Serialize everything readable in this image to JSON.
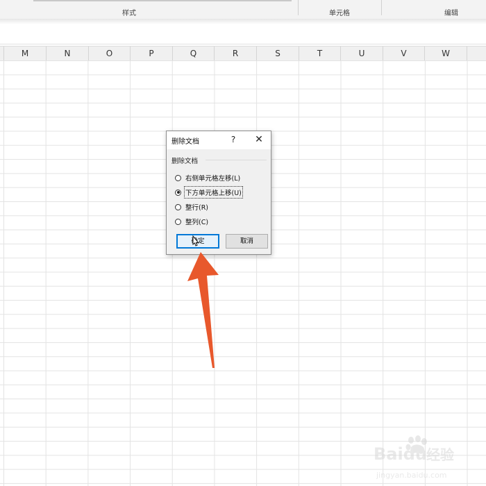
{
  "ribbon": {
    "groups": [
      "样式",
      "单元格",
      "编辑"
    ]
  },
  "columns": [
    "M",
    "N",
    "O",
    "P",
    "Q",
    "R",
    "S",
    "T",
    "U",
    "V",
    "W"
  ],
  "dialog": {
    "title": "删除文档",
    "help": "?",
    "close": "✕",
    "group_label": "删除文档",
    "options": [
      {
        "label": "右侧单元格左移(L)",
        "checked": false
      },
      {
        "label": "下方单元格上移(U)",
        "checked": true
      },
      {
        "label": "整行(R)",
        "checked": false
      },
      {
        "label": "整列(C)",
        "checked": false
      }
    ],
    "ok_label": "确定",
    "cancel_label": "取消"
  },
  "annotation": {
    "arrow_color": "#e8582c"
  },
  "watermark": {
    "brand": "Baidu",
    "sub_brand": "经验",
    "url": "jingyan.baidu.com"
  },
  "colors": {
    "ribbon_bg": "#f3f3f3",
    "grid_line": "#e3e3e3",
    "accent_blue": "#0078d7"
  }
}
